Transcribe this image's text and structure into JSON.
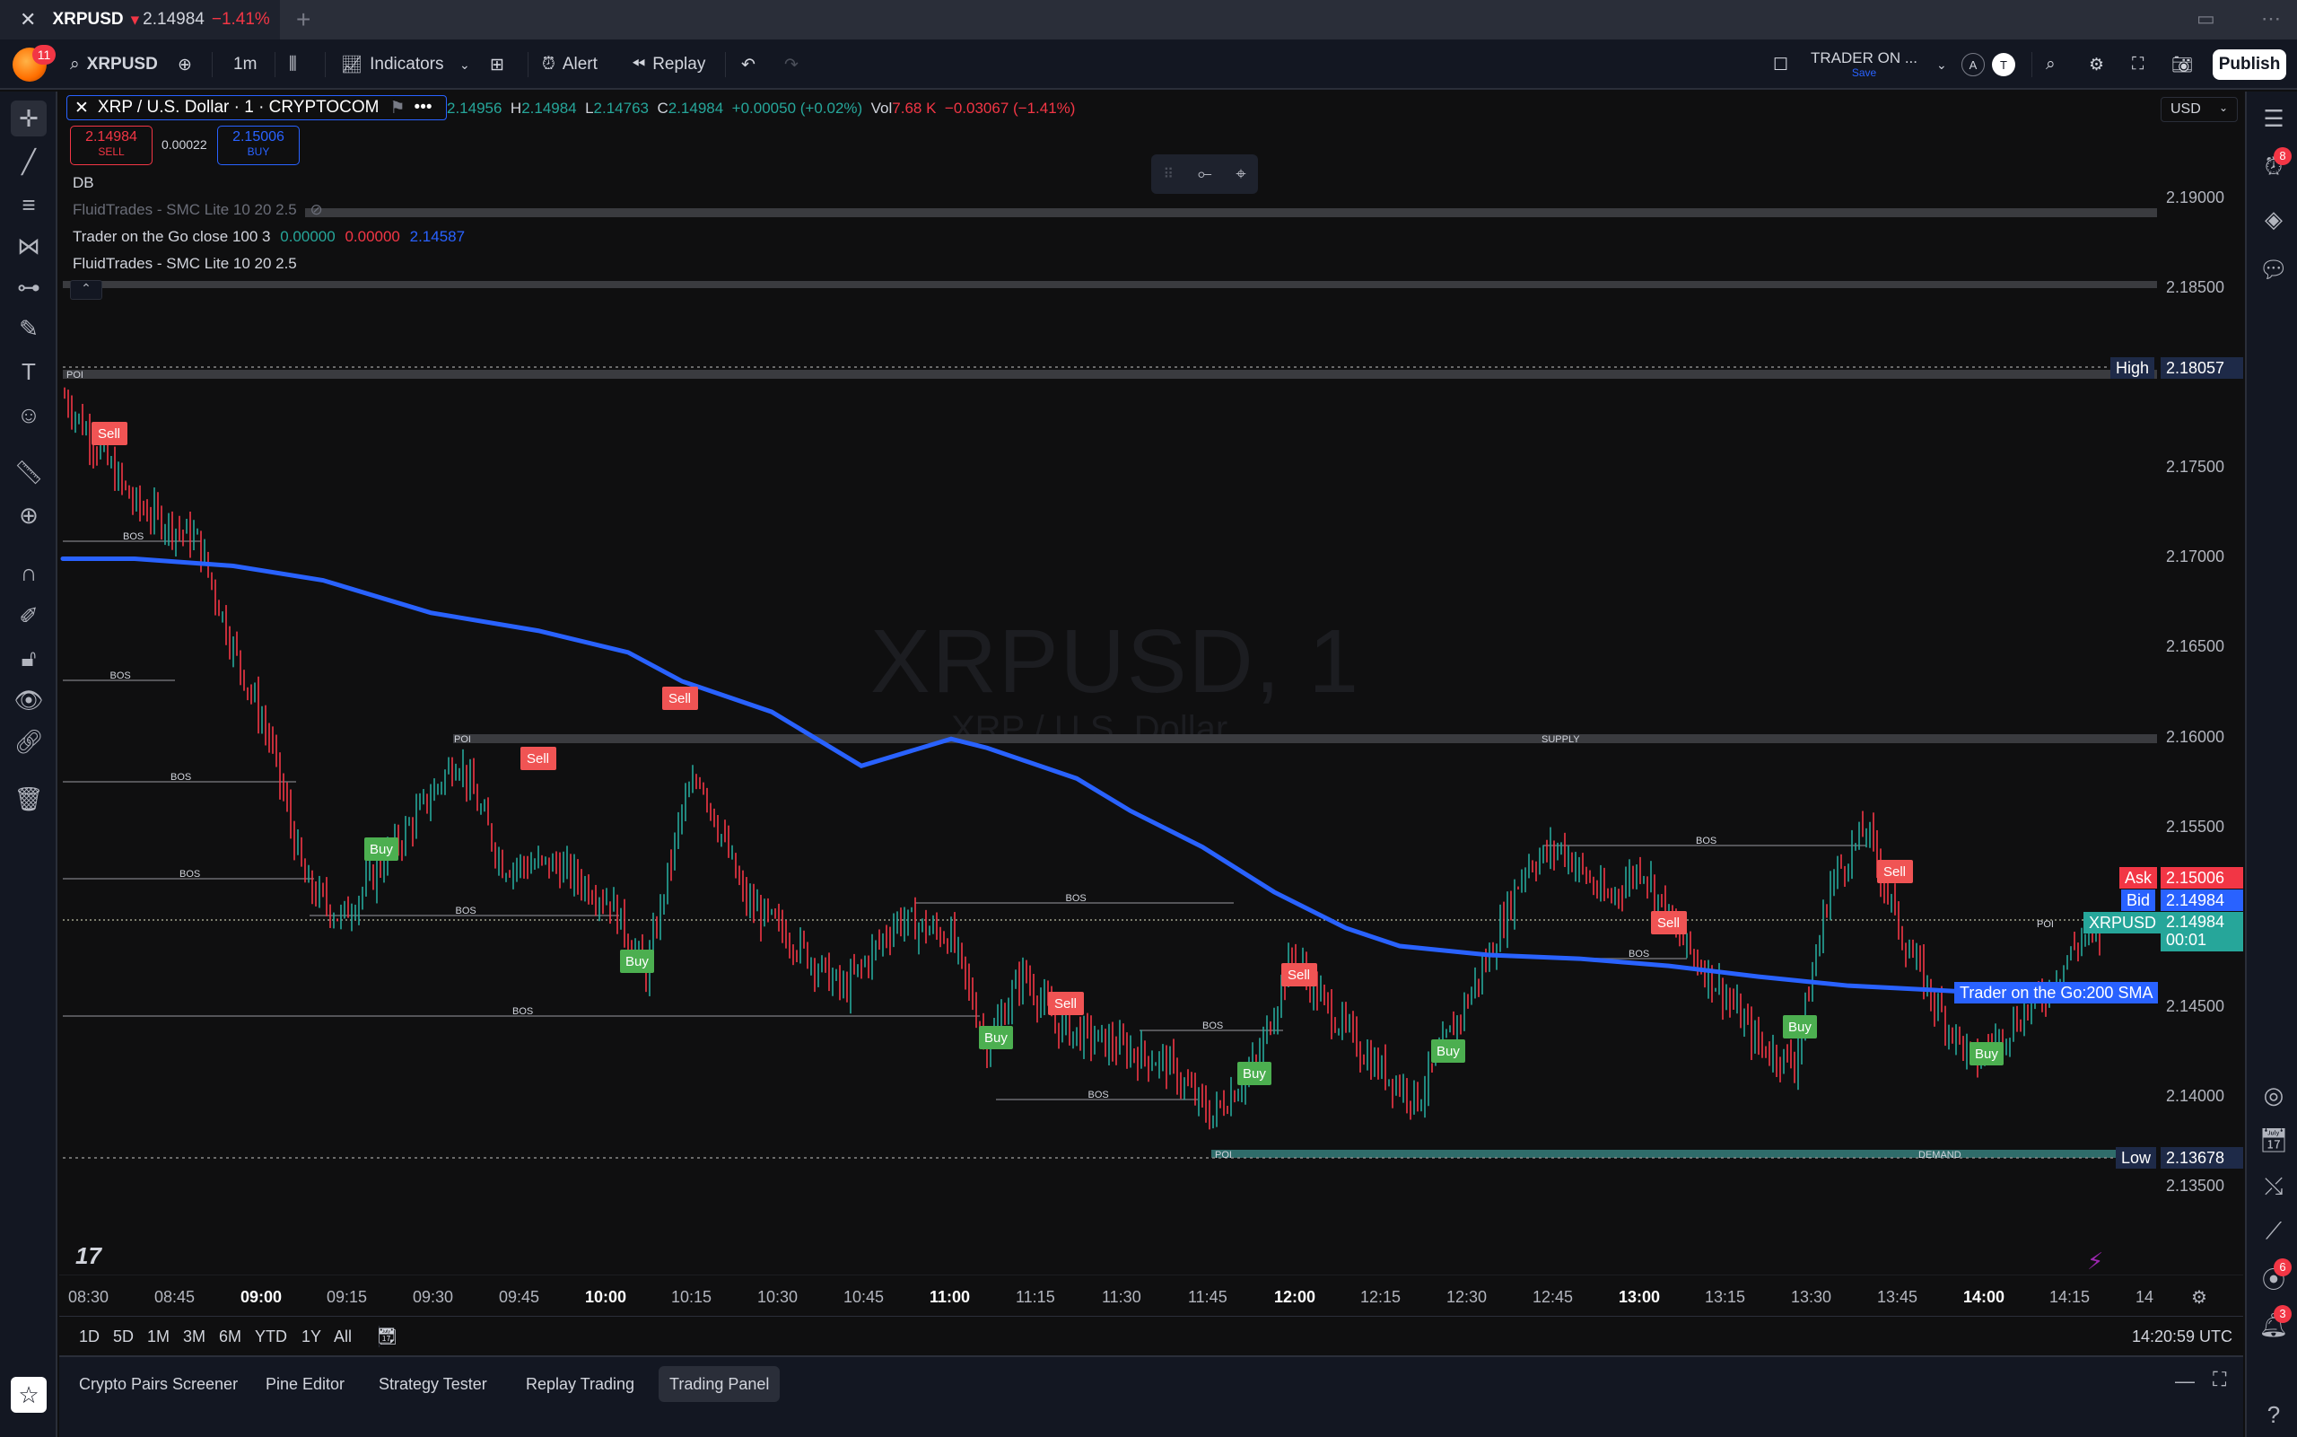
{
  "tab": {
    "symbol": "XRPUSD",
    "arrow": "▾",
    "price": "2.14984",
    "change": "−1.41%",
    "close": "✕",
    "new": "+"
  },
  "toolbar": {
    "badge": "11",
    "symbol": "XRPUSD",
    "interval": "1m",
    "indicators": "Indicators",
    "alert": "Alert",
    "replay": "Replay",
    "layout_name": "TRADER ON ...",
    "layout_save": "Save",
    "user_a": "A",
    "user_t": "T",
    "publish": "Publish"
  },
  "legend": {
    "title": "XRP / U.S. Dollar · 1 · CRYPTOCOM",
    "o": "2.14956",
    "h": "2.14984",
    "l": "2.14763",
    "c": "2.14984",
    "change": "+0.00050 (+0.02%)",
    "vol": "7.68 K",
    "vol_change": "−0.03067 (−1.41%)",
    "sell_price": "2.14984",
    "sell_label": "SELL",
    "buy_price": "2.15006",
    "buy_label": "BUY",
    "spread": "0.00022",
    "db": "DB",
    "ind1": "FluidTrades - SMC Lite 10 20 2.5",
    "ind2_name": "Trader on the Go close 100 3",
    "ind2_v1": "0.00000",
    "ind2_v2": "0.00000",
    "ind2_v3": "2.14587",
    "ind3": "FluidTrades - SMC Lite 10 20 2.5"
  },
  "currency": "USD",
  "watermark": {
    "symbol": "XRPUSD, 1",
    "name": "XRP / U.S. Dollar"
  },
  "price_axis": {
    "ticks": [
      "2.19000",
      "2.18500",
      "2.18057",
      "2.17500",
      "2.17000",
      "2.16500",
      "2.16000",
      "2.15500",
      "2.15000",
      "2.14500",
      "2.14000",
      "2.13500"
    ],
    "high_label": "High",
    "high_value": "2.18057",
    "low_label": "Low",
    "low_value": "2.13678",
    "ask_label": "Ask",
    "ask_value": "2.15006",
    "bid_label": "Bid",
    "bid_value": "2.14984",
    "last_label": "XRPUSD",
    "last_value": "2.14984",
    "countdown": "00:01",
    "sma_label": "Trader on the Go:200 SMA"
  },
  "time_axis": [
    "08:30",
    "08:45",
    "09:00",
    "09:15",
    "09:30",
    "09:45",
    "10:00",
    "10:15",
    "10:30",
    "10:45",
    "11:00",
    "11:15",
    "11:30",
    "11:45",
    "12:00",
    "12:15",
    "12:30",
    "12:45",
    "13:00",
    "13:15",
    "13:30",
    "13:45",
    "14:00",
    "14:15",
    "14"
  ],
  "zones": {
    "poi": "POI",
    "supply": "SUPPLY",
    "demand": "DEMAND",
    "bos": "BOS"
  },
  "signals": {
    "sell": "Sell",
    "buy": "Buy"
  },
  "ranges": [
    "1D",
    "5D",
    "1M",
    "3M",
    "6M",
    "YTD",
    "1Y",
    "All"
  ],
  "clock": "14:20:59 UTC",
  "bottom_tabs": [
    "Crypto Pairs Screener",
    "Pine Editor",
    "Strategy Tester",
    "Replay Trading",
    "Trading Panel"
  ],
  "right_badges": {
    "alerts": "8",
    "ideas": "6",
    "notifications": "3"
  },
  "colors": {
    "up": "#26a69a",
    "down": "#f23645",
    "sma": "#2962ff",
    "accent": "#2962ff"
  }
}
